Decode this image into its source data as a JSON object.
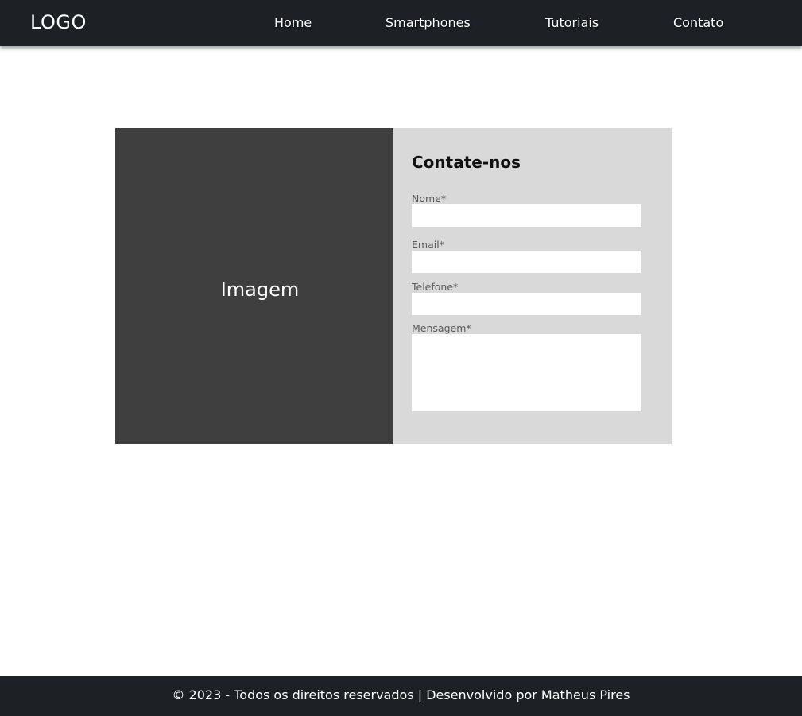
{
  "header": {
    "logo": "LOGO",
    "nav": {
      "home": "Home",
      "smartphones": "Smartphones",
      "tutoriais": "Tutoriais",
      "contato": "Contato"
    }
  },
  "image_panel": {
    "label": "Imagem"
  },
  "form": {
    "title": "Contate-nos",
    "fields": {
      "nome": {
        "label": "Nome*",
        "value": ""
      },
      "email": {
        "label": "Email*",
        "value": ""
      },
      "telefone": {
        "label": "Telefone*",
        "value": ""
      },
      "mensagem": {
        "label": "Mensagem*",
        "value": ""
      }
    }
  },
  "footer": {
    "text": "© 2023 - Todos os direitos reservados | Desenvolvido por Matheus Pires"
  },
  "colors": {
    "header_bg": "#1d2126",
    "image_panel_bg": "#3f3f3f",
    "form_panel_bg": "#d9d9d9",
    "input_bg": "#ffffff"
  }
}
